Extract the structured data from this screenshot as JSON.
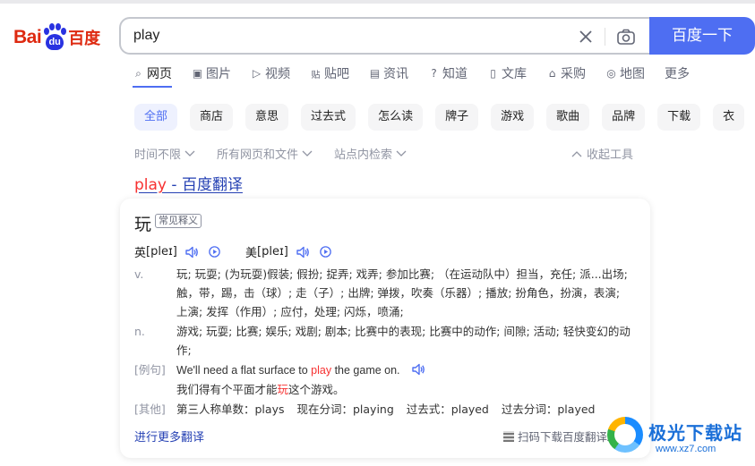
{
  "logo": {
    "text_left": "Bai",
    "text_paw": "du",
    "text_right": "百度"
  },
  "search": {
    "query": "play",
    "button_label": "百度一下"
  },
  "tabs": [
    {
      "label": "网页",
      "icon": "search-icon",
      "active": true
    },
    {
      "label": "图片",
      "icon": "image-icon"
    },
    {
      "label": "视频",
      "icon": "video-icon"
    },
    {
      "label": "贴吧",
      "icon": "tieba-icon"
    },
    {
      "label": "资讯",
      "icon": "news-icon"
    },
    {
      "label": "知道",
      "icon": "question-icon"
    },
    {
      "label": "文库",
      "icon": "document-icon"
    },
    {
      "label": "采购",
      "icon": "shopping-icon"
    },
    {
      "label": "地图",
      "icon": "map-pin-icon"
    },
    {
      "label": "更多"
    }
  ],
  "chips": [
    "全部",
    "商店",
    "意思",
    "过去式",
    "怎么读",
    "牌子",
    "游戏",
    "歌曲",
    "品牌",
    "下载",
    "衣"
  ],
  "tools": {
    "time": "时间不限",
    "filetype": "所有网页和文件",
    "site": "站点内检索",
    "collapse": "收起工具"
  },
  "result": {
    "title_hl": "play",
    "title_rest": " - 百度翻译",
    "word": "玩",
    "badge": "常见释义",
    "uk_label": "英",
    "uk_phon": "[pleɪ]",
    "us_label": "美",
    "us_phon": "[pleɪ]",
    "defs": [
      {
        "pos": "v.",
        "text": "玩; 玩耍; (为玩耍)假装; 假扮; 捉弄; 戏弄; 参加比赛; （在运动队中）担当，充任; 派...出场; 触，带，踢，击（球）; 走（子）; 出牌; 弹拨，吹奏（乐器）; 播放; 扮角色，扮演，表演; 上演; 发挥（作用）; 应付，处理; 闪烁，喷涌;"
      },
      {
        "pos": "n.",
        "text": "游戏; 玩耍; 比赛; 娱乐; 戏剧; 剧本; 比赛中的表现; 比赛中的动作; 间隙; 活动; 轻快变幻的动作;"
      }
    ],
    "example": {
      "label": "[例句]",
      "en_a": "We'll need a flat surface to ",
      "en_hl": "play",
      "en_b": " the game on.",
      "zh_a": "我们得有个平面才能",
      "zh_hl": "玩",
      "zh_b": "这个游戏。"
    },
    "other": {
      "label": "[其他]",
      "items": [
        "第三人称单数：plays",
        "现在分词：playing",
        "过去式：played",
        "过去分词：played"
      ]
    },
    "more_link": "进行更多翻译",
    "app_text": "扫码下载百度翻译APP"
  },
  "watermark": {
    "title": "极光下载站",
    "url": "www.xz7.com"
  }
}
